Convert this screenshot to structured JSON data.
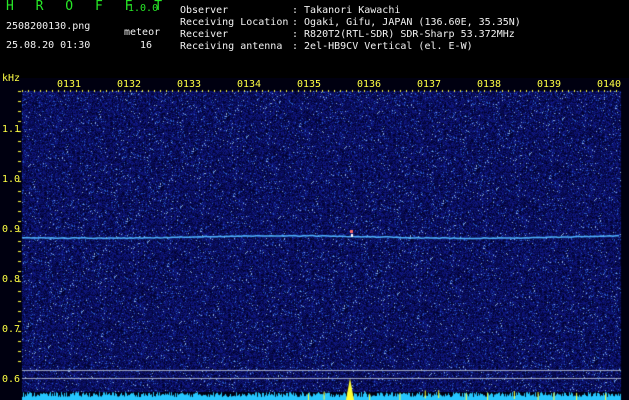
{
  "header": {
    "title": "H R O F F T",
    "version": "1.0.0",
    "file": "2508200130.png",
    "datetime": "25.08.20 01:30",
    "mode_label": "meteor",
    "mode_count": "16"
  },
  "info": [
    {
      "key": "Observer",
      "value": ": Takanori Kawachi"
    },
    {
      "key": "Receiving Location",
      "value": ": Ogaki, Gifu, JAPAN (136.60E, 35.35N)"
    },
    {
      "key": "Receiver",
      "value": ": R820T2(RTL-SDR) SDR-Sharp 53.372MHz"
    },
    {
      "key": "Receiving antenna",
      "value": ": 2el-HB9CV Vertical (el. E-W)"
    }
  ],
  "axis": {
    "unit": "kHz",
    "y_ticks": [
      "1.1",
      "1.0",
      "0.9",
      "0.8",
      "0.7",
      "0.6"
    ],
    "x_ticks": [
      "0131",
      "0132",
      "0133",
      "0134",
      "0135",
      "0136",
      "0137",
      "0138",
      "0139",
      "0140"
    ]
  },
  "colors": {
    "background": "#000000",
    "noise": "#1a1a8c",
    "trace": "#4fb4ff",
    "axis_text": "#ffff44",
    "title": "#27e827"
  }
}
